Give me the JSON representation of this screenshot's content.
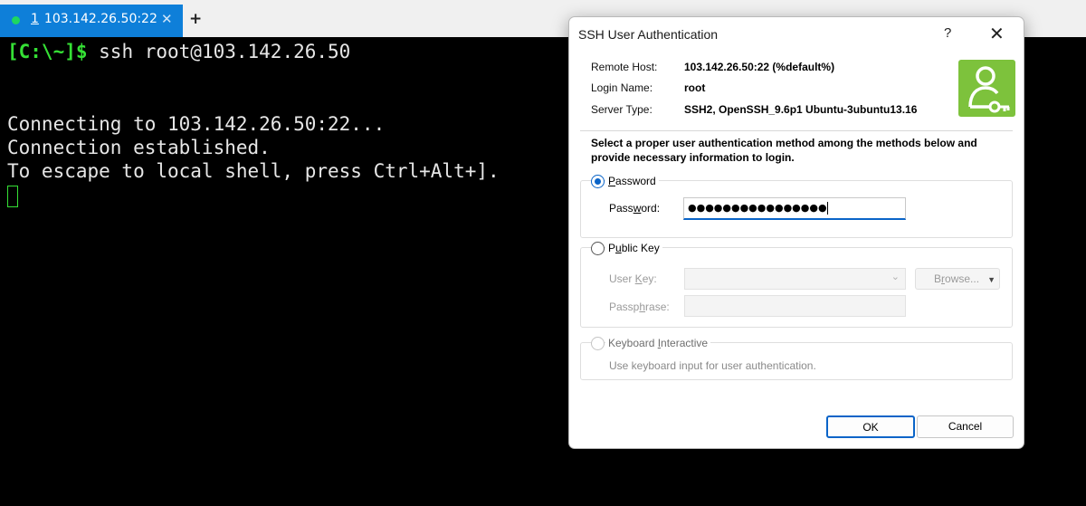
{
  "tabbar": {
    "active_tab": {
      "number": "1",
      "title": "103.142.26.50:22"
    },
    "close_glyph": "✕",
    "new_tab_glyph": "+"
  },
  "terminal": {
    "prompt": "[C:\\~]$",
    "command": " ssh root@103.142.26.50",
    "lines": [
      "Connecting to 103.142.26.50:22...",
      "Connection established.",
      "To escape to local shell, press Ctrl+Alt+]."
    ]
  },
  "dialog": {
    "title": "SSH User Authentication",
    "help_glyph": "?",
    "close_glyph": "✕",
    "info": {
      "remote_host_label": "Remote Host:",
      "remote_host": "103.142.26.50:22 (%default%)",
      "login_name_label": "Login Name:",
      "login_name": "root",
      "server_type_label": "Server Type:",
      "server_type": "SSH2, OpenSSH_9.6p1 Ubuntu-3ubuntu13.16"
    },
    "instructions": "Select a proper user authentication method among the methods below and provide necessary information to login.",
    "password_method": {
      "label_first": "P",
      "label_rest": "assword",
      "field_label_a": "Pass",
      "field_label_u": "w",
      "field_label_b": "ord:",
      "value": "●●●●●●●●●●●●●●●●",
      "selected": true
    },
    "public_key_method": {
      "label_first": "P",
      "label_u": "u",
      "label_rest": "blic Key",
      "user_key_a": "User ",
      "user_key_u": "K",
      "user_key_b": "ey:",
      "browse_a": "B",
      "browse_u": "r",
      "browse_b": "owse...",
      "passphrase_a": "Passp",
      "passphrase_u": "h",
      "passphrase_b": "rase:"
    },
    "keyboard_method": {
      "label_a": "Keyboard ",
      "label_u": "I",
      "label_b": "nteractive",
      "description": "Use keyboard input for user authentication."
    },
    "ok_label": "OK",
    "cancel_label": "Cancel",
    "colors": {
      "accent": "#0a64c8",
      "logo": "#7dc23c",
      "tab": "#0e7fd9",
      "prompt": "#35e035"
    }
  }
}
